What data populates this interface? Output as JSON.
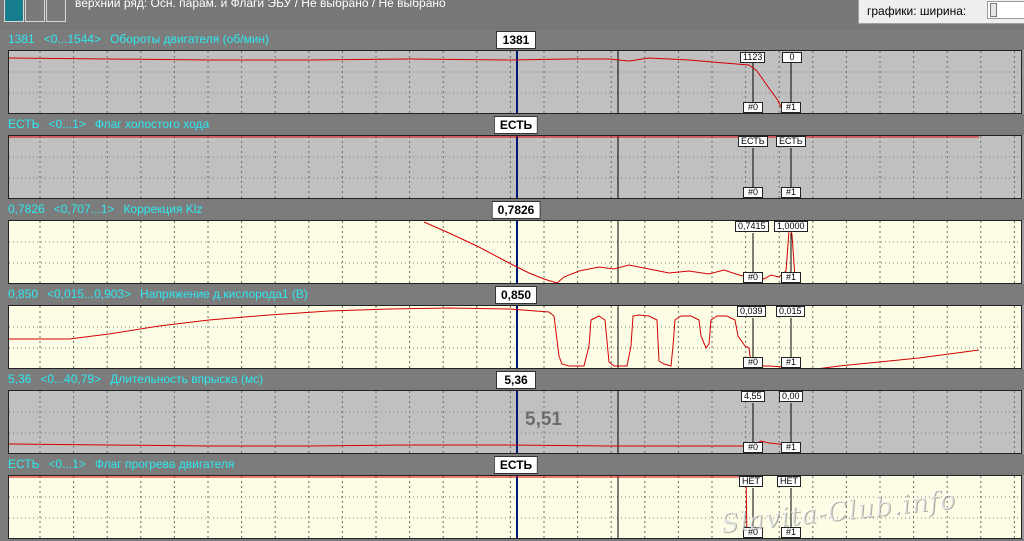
{
  "toolbar": {
    "caption": "верхний ряд: Осн. парам. и Флаги ЭБУ / Не выбрано / Не выбрано",
    "size_label": "графики:  ширина:",
    "icons": [
      "layout-grid-icon"
    ]
  },
  "colors": {
    "cyan_label": "#2ee9f0",
    "cursor_line": "#001a7a",
    "trace": "#d40000",
    "plot_gray": "#c0c0c0",
    "plot_cream": "#fdfde6"
  },
  "markers": {
    "hash0": "#0",
    "hash1": "#1"
  },
  "panels": [
    {
      "id": "rpm",
      "current": "1381",
      "range": "<0...1544>",
      "name": "Обороты двигателя (об/мин)",
      "cursor_value": "1381",
      "bg": "gray",
      "m0": "1123",
      "m1": "0",
      "big_value": ""
    },
    {
      "id": "idle",
      "current": "ЕСТЬ",
      "range": "<0...1>",
      "name": "Флаг холостого хода",
      "cursor_value": "ЕСТЬ",
      "bg": "gray",
      "m0": "ЕСТЬ",
      "m1": "ЕСТЬ",
      "big_value": ""
    },
    {
      "id": "klz",
      "current": "0,7826",
      "range": "<0,707...1>",
      "name": "Коррекция Klz",
      "cursor_value": "0,7826",
      "bg": "cream",
      "m0": "0,7415",
      "m1": "1,0000",
      "big_value": ""
    },
    {
      "id": "o2",
      "current": "0,850",
      "range": "<0,015...0,903>",
      "name": "Напряжение д.кислорода1 (В)",
      "cursor_value": "0,850",
      "bg": "cream",
      "m0": "0,039",
      "m1": "0,015",
      "big_value": ""
    },
    {
      "id": "inj",
      "current": "5,36",
      "range": "<0...40,79>",
      "name": "Длительность впрыска (мс)",
      "cursor_value": "5,36",
      "bg": "gray",
      "m0": "4,55",
      "m1": "0,00",
      "big_value": "5,51"
    },
    {
      "id": "warm",
      "current": "ЕСТЬ",
      "range": "<0...1>",
      "name": "Флаг прогрева двигателя",
      "cursor_value": "ЕСТЬ",
      "bg": "cream",
      "m0": "НЕТ",
      "m1": "НЕТ",
      "big_value": ""
    }
  ],
  "watermark": "Slavita-Club.info"
}
